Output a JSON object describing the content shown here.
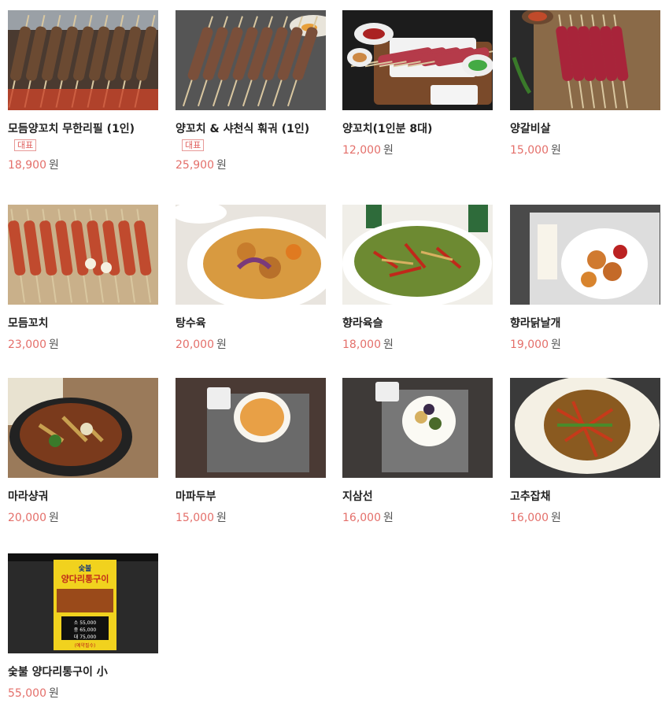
{
  "currency_unit": "원",
  "badge_label": "대표",
  "colors": {
    "price": "#e46f6a",
    "badge": "#e0605e",
    "name": "#222222"
  },
  "menu_items": [
    {
      "name": "모듬양꼬치 무한리필 (1인)",
      "badge": true,
      "price": "18,900",
      "image": "grilled-skewers-photo"
    },
    {
      "name": "양꼬치 & 샤천식 훠궈 (1인)",
      "badge": true,
      "price": "25,900",
      "image": "skewers-on-grill-photo"
    },
    {
      "name": "양꼬치(1인분 8대)",
      "badge": false,
      "price": "12,000",
      "image": "raw-lamb-skewers-platter-photo"
    },
    {
      "name": "양갈비살",
      "badge": false,
      "price": "15,000",
      "image": "lamb-rib-skewers-photo"
    },
    {
      "name": "모듬꼬치",
      "badge": false,
      "price": "23,000",
      "image": "assorted-skewers-photo"
    },
    {
      "name": "탕수육",
      "badge": false,
      "price": "20,000",
      "image": "sweet-sour-pork-photo"
    },
    {
      "name": "향라육슬",
      "badge": false,
      "price": "18,000",
      "image": "spicy-shredded-pork-photo"
    },
    {
      "name": "향라닭날개",
      "badge": false,
      "price": "19,000",
      "image": "spicy-chicken-wings-photo"
    },
    {
      "name": "마라샹궈",
      "badge": false,
      "price": "20,000",
      "image": "mala-xiangguo-photo"
    },
    {
      "name": "마파두부",
      "badge": false,
      "price": "15,000",
      "image": "mapo-tofu-photo"
    },
    {
      "name": "지삼선",
      "badge": false,
      "price": "16,000",
      "image": "disanxian-photo"
    },
    {
      "name": "고추잡채",
      "badge": false,
      "price": "16,000",
      "image": "pepper-japchae-photo"
    },
    {
      "name": "숯불 양다리통구이 小",
      "badge": false,
      "price": "55,000",
      "image": "charcoal-lamb-leg-poster-photo",
      "poster": {
        "brand": "숯불",
        "title": "양다리통구이",
        "lines": [
          "소 55,000",
          "중 65,000",
          "대 75,000"
        ],
        "note": "(예약필수)"
      }
    }
  ]
}
